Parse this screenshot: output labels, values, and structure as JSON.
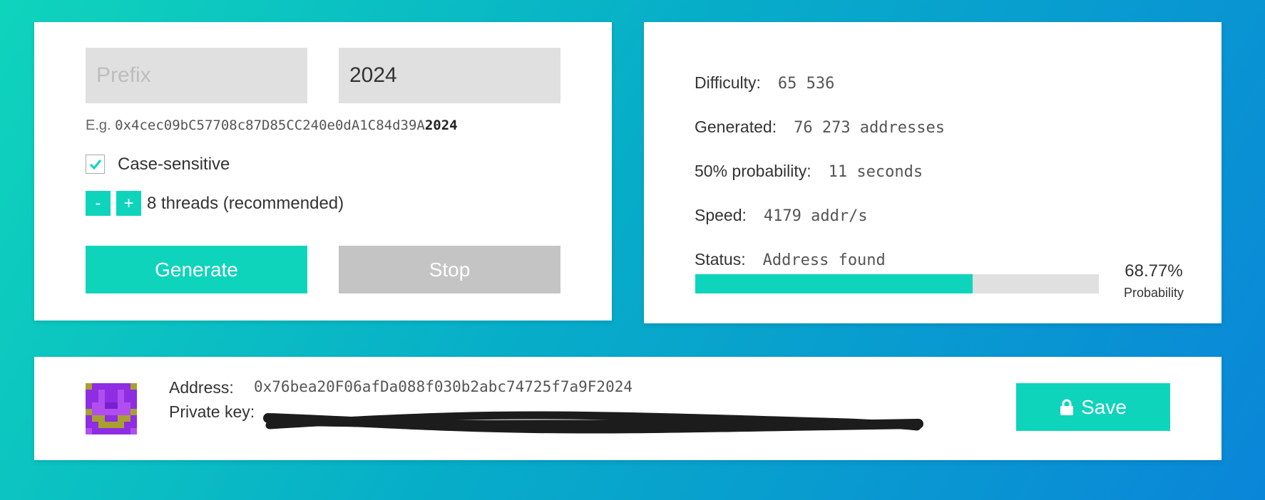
{
  "input": {
    "prefix_placeholder": "Prefix",
    "suffix_value": "2024",
    "example_label": "E.g.",
    "example_address": "0x4cec09bC57708c87D85CC240e0dA1C84d39A",
    "example_suffix": "2024",
    "case_sensitive_label": "Case-sensitive",
    "case_sensitive_checked": true,
    "minus_label": "-",
    "plus_label": "+",
    "threads_label": "8 threads (recommended)",
    "generate_label": "Generate",
    "stop_label": "Stop"
  },
  "stats": {
    "difficulty_label": "Difficulty:",
    "difficulty_value": "65 536",
    "generated_label": "Generated:",
    "generated_value": "76 273 addresses",
    "probability50_label": "50% probability:",
    "probability50_value": "11 seconds",
    "speed_label": "Speed:",
    "speed_value": "4179 addr/s",
    "status_label": "Status:",
    "status_value": "Address found",
    "probability_percent": 68.77,
    "probability_text": "68.77%",
    "probability_label": "Probability"
  },
  "result": {
    "address_label": "Address:",
    "address_value": "0x76bea20F06afDa088f030b2abc74725f7a9F2024",
    "private_key_label": "Private key:",
    "save_label": "Save",
    "save_icon": "lock-icon"
  },
  "colors": {
    "accent": "#0fd4bc",
    "stop_gray": "#c4c4c4",
    "field_gray": "#e0e0e0"
  }
}
